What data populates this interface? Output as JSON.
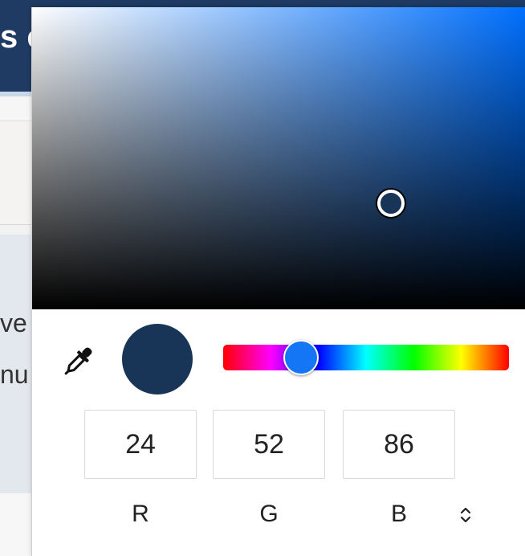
{
  "background": {
    "header_text": "s e",
    "line1": "ve",
    "line2": "nu"
  },
  "picker": {
    "current_color": "#183456",
    "hue_color": "#1475f5",
    "hue_position_pct": 24,
    "saturation_pct": 72,
    "brightness_pct": 34,
    "rgb": {
      "r": "24",
      "g": "52",
      "b": "86"
    },
    "labels": {
      "r": "R",
      "g": "G",
      "b": "B"
    },
    "icons": {
      "eyedropper": "eyedropper-icon",
      "mode_toggle": "chevron-up-down-icon"
    }
  }
}
